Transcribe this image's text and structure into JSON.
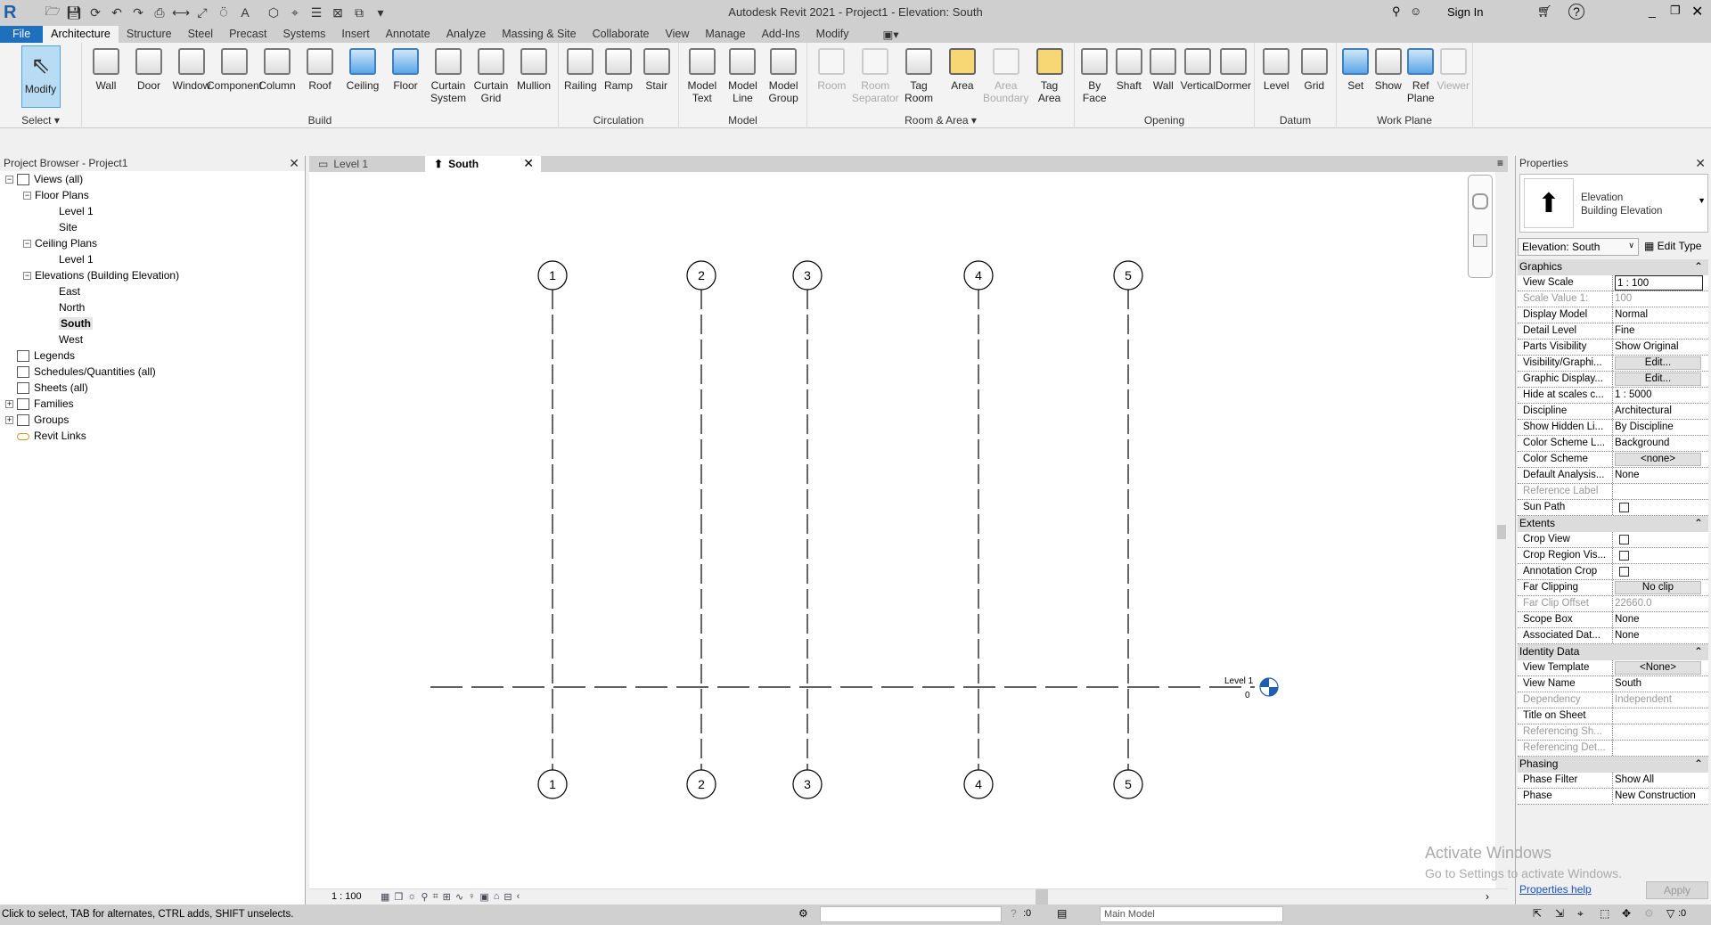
{
  "window": {
    "title": "Autodesk Revit 2021 - Project1 - Elevation: South",
    "sign_in": "Sign In"
  },
  "ribbon_tabs": [
    "File",
    "Architecture",
    "Structure",
    "Steel",
    "Precast",
    "Systems",
    "Insert",
    "Annotate",
    "Analyze",
    "Massing & Site",
    "Collaborate",
    "View",
    "Manage",
    "Add-Ins",
    "Modify"
  ],
  "active_tab": "Architecture",
  "ribbon_panels": [
    {
      "label": "Select ▾",
      "buttons": [
        {
          "label": "Modify",
          "icon": "cursor-arrow-icon",
          "selected": true
        }
      ]
    },
    {
      "label": "Build",
      "buttons": [
        {
          "label": "Wall",
          "icon": "wall-icon"
        },
        {
          "label": "Door",
          "icon": "door-icon"
        },
        {
          "label": "Window",
          "icon": "window-icon"
        },
        {
          "label": "Component",
          "icon": "component-icon"
        },
        {
          "label": "Column",
          "icon": "column-icon"
        },
        {
          "label": "Roof",
          "icon": "roof-icon"
        },
        {
          "label": "Ceiling",
          "icon": "ceiling-icon",
          "tint": "blue"
        },
        {
          "label": "Floor",
          "icon": "floor-icon",
          "tint": "blue"
        },
        {
          "label": "Curtain System",
          "icon": "curtain-system-icon"
        },
        {
          "label": "Curtain Grid",
          "icon": "curtain-grid-icon"
        },
        {
          "label": "Mullion",
          "icon": "mullion-icon"
        }
      ]
    },
    {
      "label": "Circulation",
      "buttons": [
        {
          "label": "Railing",
          "icon": "railing-icon"
        },
        {
          "label": "Ramp",
          "icon": "ramp-icon"
        },
        {
          "label": "Stair",
          "icon": "stair-icon"
        }
      ]
    },
    {
      "label": "Model",
      "buttons": [
        {
          "label": "Model Text",
          "icon": "model-text-icon"
        },
        {
          "label": "Model Line",
          "icon": "model-line-icon"
        },
        {
          "label": "Model Group",
          "icon": "model-group-icon"
        }
      ]
    },
    {
      "label": "Room & Area ▾",
      "buttons": [
        {
          "label": "Room",
          "icon": "room-icon",
          "disabled": true
        },
        {
          "label": "Room Separator",
          "icon": "room-separator-icon",
          "disabled": true
        },
        {
          "label": "Tag Room",
          "icon": "tag-room-icon"
        },
        {
          "label": "Area",
          "icon": "area-icon",
          "tint": "yellow"
        },
        {
          "label": "Area Boundary",
          "icon": "area-boundary-icon",
          "disabled": true
        },
        {
          "label": "Tag Area",
          "icon": "tag-area-icon",
          "tint": "yellow"
        }
      ]
    },
    {
      "label": "Opening",
      "buttons": [
        {
          "label": "By Face",
          "icon": "by-face-icon"
        },
        {
          "label": "Shaft",
          "icon": "shaft-icon"
        },
        {
          "label": "Wall",
          "icon": "wall-opening-icon"
        },
        {
          "label": "Vertical",
          "icon": "vertical-opening-icon"
        },
        {
          "label": "Dormer",
          "icon": "dormer-icon"
        }
      ]
    },
    {
      "label": "Datum",
      "buttons": [
        {
          "label": "Level",
          "icon": "level-icon"
        },
        {
          "label": "Grid",
          "icon": "grid-icon"
        }
      ]
    },
    {
      "label": "Work Plane",
      "buttons": [
        {
          "label": "Set",
          "icon": "set-workplane-icon",
          "tint": "blue"
        },
        {
          "label": "Show",
          "icon": "show-workplane-icon"
        },
        {
          "label": "Ref Plane",
          "icon": "ref-plane-icon",
          "tint": "blue"
        },
        {
          "label": "Viewer",
          "icon": "viewer-icon",
          "disabled": true
        }
      ]
    }
  ],
  "project_browser": {
    "title": "Project Browser - Project1",
    "items": [
      {
        "label": "Views (all)",
        "depth": 0,
        "toggle": "−",
        "icon": "views-icon"
      },
      {
        "label": "Floor Plans",
        "depth": 1,
        "toggle": "−"
      },
      {
        "label": "Level 1",
        "depth": 2
      },
      {
        "label": "Site",
        "depth": 2
      },
      {
        "label": "Ceiling Plans",
        "depth": 1,
        "toggle": "−"
      },
      {
        "label": "Level 1",
        "depth": 2
      },
      {
        "label": "Elevations (Building Elevation)",
        "depth": 1,
        "toggle": "−"
      },
      {
        "label": "East",
        "depth": 2
      },
      {
        "label": "North",
        "depth": 2
      },
      {
        "label": "South",
        "depth": 2,
        "selected": true
      },
      {
        "label": "West",
        "depth": 2
      },
      {
        "label": "Legends",
        "depth": 0,
        "icon": "legends-icon"
      },
      {
        "label": "Schedules/Quantities (all)",
        "depth": 0,
        "icon": "schedules-icon"
      },
      {
        "label": "Sheets (all)",
        "depth": 0,
        "icon": "sheets-icon"
      },
      {
        "label": "Families",
        "depth": 0,
        "toggle": "+",
        "icon": "families-icon"
      },
      {
        "label": "Groups",
        "depth": 0,
        "toggle": "+",
        "icon": "groups-icon"
      },
      {
        "label": "Revit Links",
        "depth": 0,
        "icon": "revit-links-icon"
      }
    ]
  },
  "view_tabs": [
    {
      "label": "Level 1",
      "icon": "floor-plan-icon"
    },
    {
      "label": "South",
      "icon": "elevation-icon",
      "active": true
    }
  ],
  "drawing": {
    "grids": [
      "1",
      "2",
      "3",
      "4",
      "5"
    ],
    "level": {
      "name": "Level 1",
      "elevation": "0"
    }
  },
  "view_control": {
    "scale": "1 : 100"
  },
  "properties": {
    "title": "Properties",
    "type_family": "Elevation",
    "type_name": "Building Elevation",
    "instance_selector": "Elevation: South",
    "edit_type": "Edit Type",
    "groups": [
      {
        "name": "Graphics",
        "rows": [
          {
            "label": "View Scale",
            "value": "1 : 100",
            "kind": "input"
          },
          {
            "label": "Scale Value    1:",
            "value": "100",
            "disabled": true
          },
          {
            "label": "Display Model",
            "value": "Normal"
          },
          {
            "label": "Detail Level",
            "value": "Fine"
          },
          {
            "label": "Parts Visibility",
            "value": "Show Original"
          },
          {
            "label": "Visibility/Graphi...",
            "value": "Edit...",
            "kind": "button"
          },
          {
            "label": "Graphic Display...",
            "value": "Edit...",
            "kind": "button"
          },
          {
            "label": "Hide at scales c...",
            "value": "1 : 5000"
          },
          {
            "label": "Discipline",
            "value": "Architectural"
          },
          {
            "label": "Show Hidden Li...",
            "value": "By Discipline"
          },
          {
            "label": "Color Scheme L...",
            "value": "Background"
          },
          {
            "label": "Color Scheme",
            "value": "<none>",
            "kind": "button"
          },
          {
            "label": "Default Analysis...",
            "value": "None"
          },
          {
            "label": "Reference Label",
            "value": "",
            "disabled": true
          },
          {
            "label": "Sun Path",
            "value": "",
            "kind": "checkbox",
            "checked": false
          }
        ]
      },
      {
        "name": "Extents",
        "rows": [
          {
            "label": "Crop View",
            "value": "",
            "kind": "checkbox",
            "checked": false
          },
          {
            "label": "Crop Region Vis...",
            "value": "",
            "kind": "checkbox",
            "checked": false
          },
          {
            "label": "Annotation Crop",
            "value": "",
            "kind": "checkbox",
            "checked": false
          },
          {
            "label": "Far Clipping",
            "value": "No clip",
            "kind": "button"
          },
          {
            "label": "Far Clip Offset",
            "value": "22660.0",
            "disabled": true
          },
          {
            "label": "Scope Box",
            "value": "None"
          },
          {
            "label": "Associated Dat...",
            "value": "None"
          }
        ]
      },
      {
        "name": "Identity Data",
        "rows": [
          {
            "label": "View Template",
            "value": "<None>",
            "kind": "button"
          },
          {
            "label": "View Name",
            "value": "South"
          },
          {
            "label": "Dependency",
            "value": "Independent",
            "disabled": true
          },
          {
            "label": "Title on Sheet",
            "value": ""
          },
          {
            "label": "Referencing Sh...",
            "value": "",
            "disabled": true
          },
          {
            "label": "Referencing Det...",
            "value": "",
            "disabled": true
          }
        ]
      },
      {
        "name": "Phasing",
        "rows": [
          {
            "label": "Phase Filter",
            "value": "Show All"
          },
          {
            "label": "Phase",
            "value": "New Construction"
          }
        ]
      }
    ],
    "help_link": "Properties help",
    "apply": "Apply"
  },
  "watermark": {
    "line1": "Activate Windows",
    "line2": "Go to Settings to activate Windows."
  },
  "status": {
    "message": "Click to select, TAB for alternates, CTRL adds, SHIFT unselects.",
    "workset_count": ":0",
    "design_option": "Main Model",
    "filter_count": ":0"
  },
  "colors": {
    "file_tab": "#1f6fbf",
    "level_head": "#1f5fb0",
    "selection": "#b9dcf5"
  }
}
